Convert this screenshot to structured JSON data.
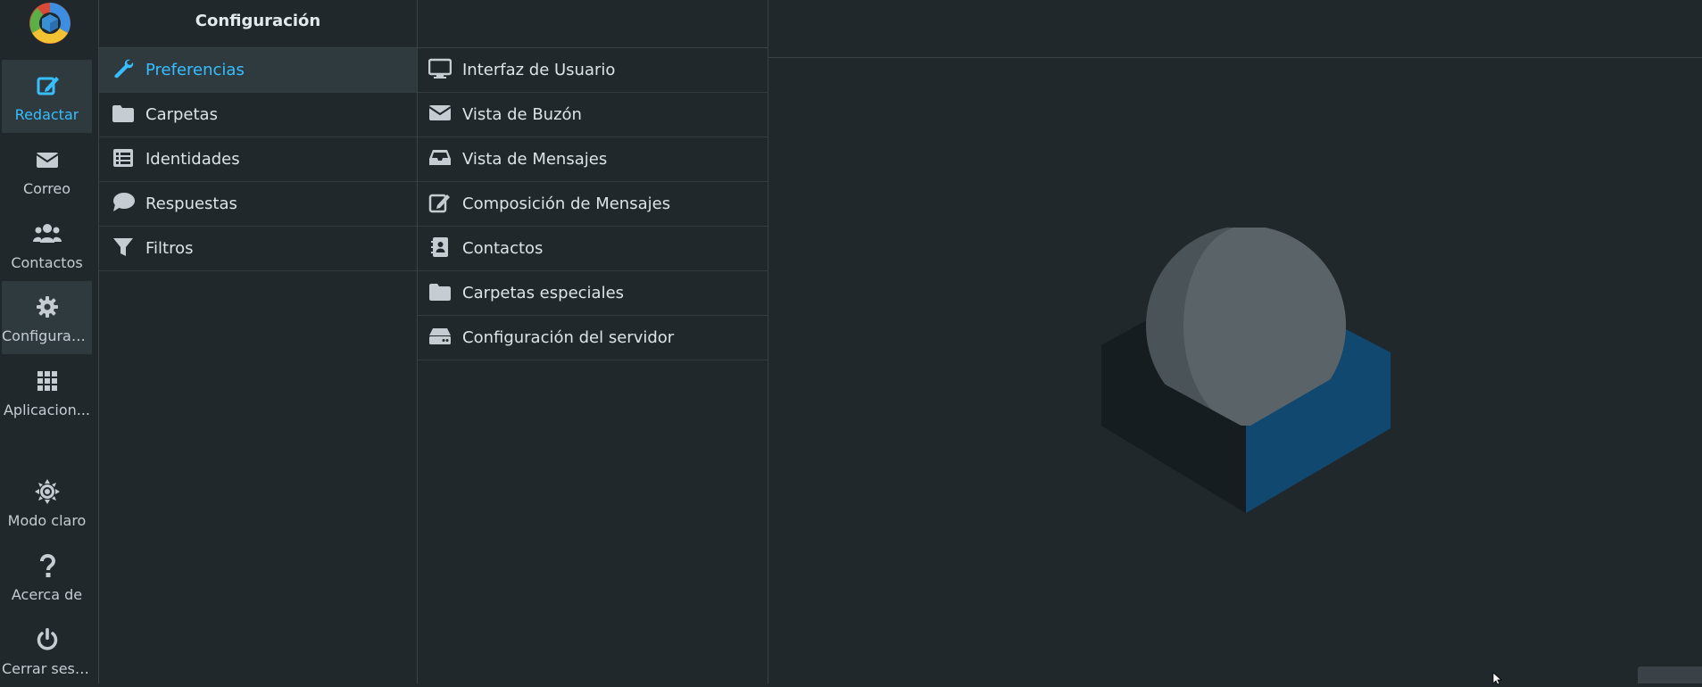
{
  "taskmenu": {
    "items": [
      {
        "label": "Redactar",
        "icon": "compose-icon"
      },
      {
        "label": "Correo",
        "icon": "envelope-icon"
      },
      {
        "label": "Contactos",
        "icon": "users-icon"
      },
      {
        "label": "Configurac...",
        "icon": "gear-icon"
      },
      {
        "label": "Aplicacion...",
        "icon": "grid-icon"
      },
      {
        "label": "Modo claro",
        "icon": "sun-icon"
      },
      {
        "label": "Acerca de",
        "icon": "question-icon"
      },
      {
        "label": "Cerrar sesi...",
        "icon": "power-icon"
      }
    ]
  },
  "settings": {
    "title": "Configuración",
    "tabs": [
      {
        "label": "Preferencias",
        "icon": "wrench-icon",
        "active": true
      },
      {
        "label": "Carpetas",
        "icon": "folder-icon"
      },
      {
        "label": "Identidades",
        "icon": "id-list-icon"
      },
      {
        "label": "Respuestas",
        "icon": "speech-bubble-icon"
      },
      {
        "label": "Filtros",
        "icon": "filter-icon"
      }
    ]
  },
  "sections": {
    "items": [
      {
        "label": "Interfaz de Usuario",
        "icon": "monitor-icon"
      },
      {
        "label": "Vista de Buzón",
        "icon": "envelope-icon"
      },
      {
        "label": "Vista de Mensajes",
        "icon": "inbox-tray-icon"
      },
      {
        "label": "Composición de Mensajes",
        "icon": "compose-icon"
      },
      {
        "label": "Contactos",
        "icon": "address-book-icon"
      },
      {
        "label": "Carpetas especiales",
        "icon": "folder-icon"
      },
      {
        "label": "Configuración del servidor",
        "icon": "server-icon"
      }
    ]
  },
  "colors": {
    "background": "#21282c",
    "accent": "#37beff",
    "active_row": "#2f3a3f",
    "border": "#3b4246"
  }
}
